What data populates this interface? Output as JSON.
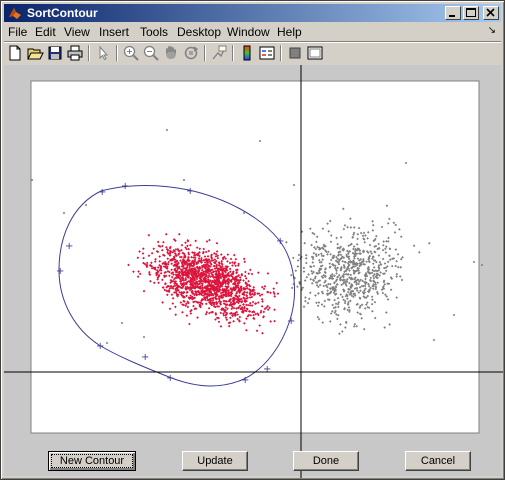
{
  "window": {
    "title": "SortContour"
  },
  "titlebar_buttons": {
    "minimize": "_",
    "maximize": "□",
    "close": "×"
  },
  "menu": {
    "items": [
      {
        "label": "File",
        "name": "menu-file"
      },
      {
        "label": "Edit",
        "name": "menu-edit"
      },
      {
        "label": "View",
        "name": "menu-view"
      },
      {
        "label": "Insert",
        "name": "menu-insert"
      },
      {
        "label": "Tools",
        "name": "menu-tools"
      },
      {
        "label": "Desktop",
        "name": "menu-desktop"
      },
      {
        "label": "Window",
        "name": "menu-window"
      },
      {
        "label": "Help",
        "name": "menu-help"
      }
    ],
    "dock_arrow": "↘"
  },
  "toolbar": {
    "tools": [
      "new-figure-icon",
      "open-file-icon",
      "save-icon",
      "print-icon",
      "select-arrow-icon",
      "zoom-in-icon",
      "zoom-out-icon",
      "pan-hand-icon",
      "rotate-3d-icon",
      "data-cursor-icon",
      "colorbar-icon",
      "legend-icon",
      "hide-plot-tools-icon",
      "show-plot-tools-icon"
    ]
  },
  "plot": {
    "colors": {
      "selected": "#dc143c",
      "unselected": "#808080",
      "contour": "#3c3c9a",
      "crosshair": "#000000",
      "axes_bg": "#ffffff"
    },
    "contour_vertex_marker": "+"
  },
  "buttons": {
    "new_contour": "New Contour",
    "update": "Update",
    "done": "Done",
    "cancel": "Cancel"
  }
}
